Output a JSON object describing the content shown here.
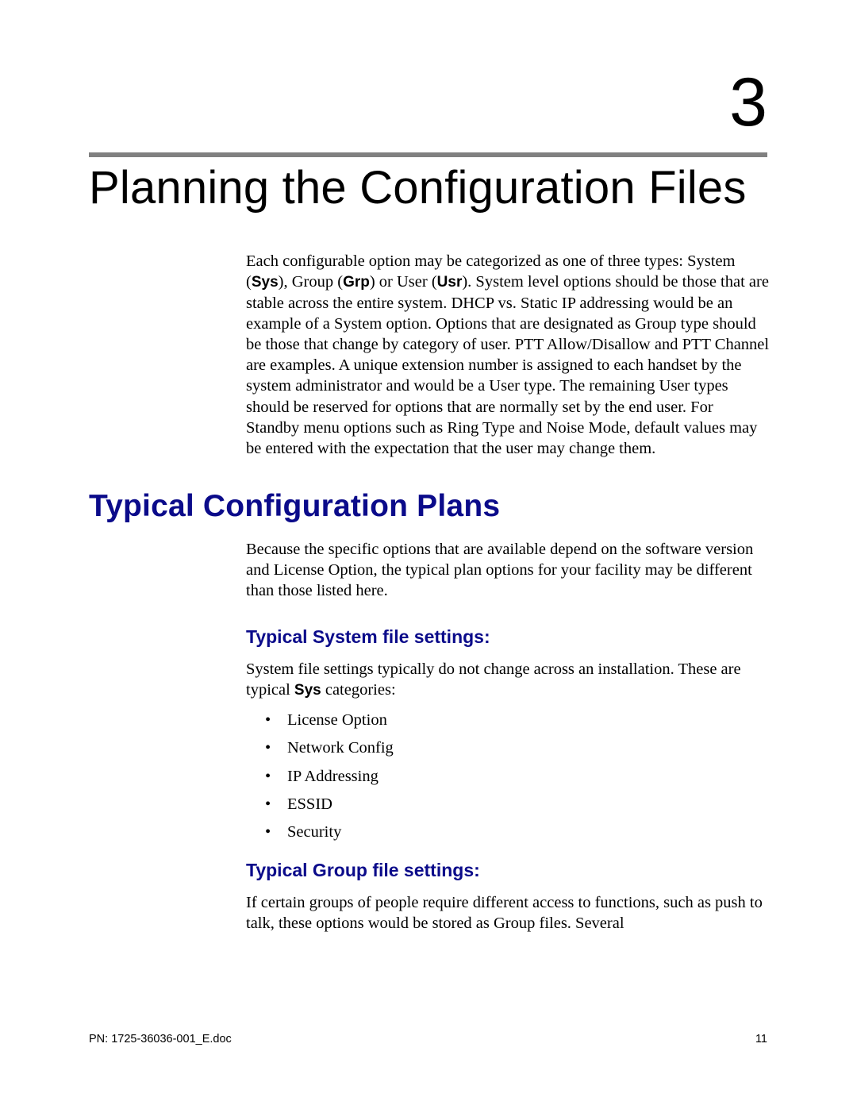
{
  "chapter": {
    "number": "3",
    "title": "Planning the Configuration Files"
  },
  "intro": {
    "seg1": "Each configurable option may be categorized as one of three types: System (",
    "sys": "Sys",
    "seg2": "), Group (",
    "grp": "Grp",
    "seg3": ") or User (",
    "usr": "Usr",
    "seg4": "). System level options should be those that are stable across the entire system. DHCP vs. Static IP addressing would be an example of a System option. Options that are designated as Group type should be those that change by category of user. PTT Allow/Disallow and PTT Channel are examples. A unique extension number is assigned to each handset by the system administrator and would be a User type. The remaining User types should be reserved for options that are normally set by the end user. For Standby menu options such as Ring Type and Noise Mode, default values may be entered with the expectation that the user may change them."
  },
  "section": {
    "heading": "Typical Configuration Plans",
    "intro": "Because the specific options that are available depend on the software version and License Option, the typical plan options for your facility may be different than those listed here."
  },
  "system": {
    "heading": "Typical System file settings:",
    "para_a": "System file settings typically do not change across an installation. These are typical ",
    "para_bold": "Sys",
    "para_b": " categories:",
    "items": {
      "0": "License Option",
      "1": "Network Config",
      "2": "IP Addressing",
      "3": "ESSID",
      "4": "Security"
    }
  },
  "group": {
    "heading": "Typical Group file settings:",
    "para": "If certain groups of people require different access to functions, such as push to talk, these options would be stored as Group files. Several"
  },
  "footer": {
    "pn": "PN: 1725-36036-001_E.doc",
    "page": "11"
  }
}
